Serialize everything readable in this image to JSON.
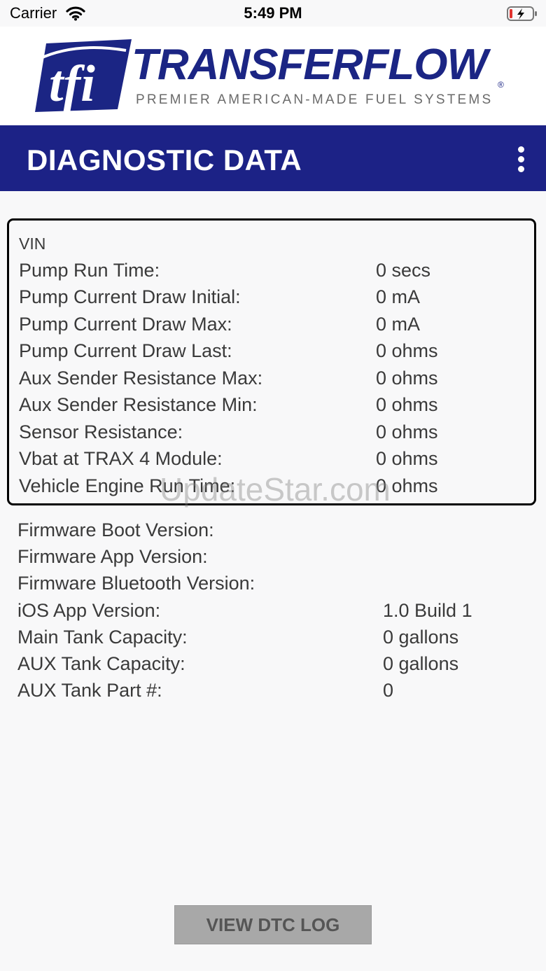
{
  "status_bar": {
    "carrier": "Carrier",
    "time": "5:49 PM",
    "wifi_icon": "wifi-icon",
    "battery_icon": "battery-charging-icon"
  },
  "brand": {
    "logo_mark": "tfi",
    "name": "TRANSFERFLOW",
    "registered": "®",
    "tagline": "PREMIER AMERICAN-MADE FUEL SYSTEMS",
    "color": "#1b2584"
  },
  "header": {
    "title": "DIAGNOSTIC DATA",
    "menu_icon": "more-vertical-icon",
    "color": "#1c2286"
  },
  "diagnostics": {
    "vin_label": "VIN",
    "rows": [
      {
        "label": "Pump Run Time:",
        "value": "0 secs"
      },
      {
        "label": "Pump Current Draw Initial:",
        "value": "0 mA"
      },
      {
        "label": "Pump Current Draw Max:",
        "value": "0 mA"
      },
      {
        "label": "Pump Current Draw Last:",
        "value": "0 ohms"
      },
      {
        "label": "Aux Sender Resistance Max:",
        "value": "0 ohms"
      },
      {
        "label": "Aux Sender Resistance Min:",
        "value": "0 ohms"
      },
      {
        "label": "Sensor Resistance:",
        "value": "0 ohms"
      },
      {
        "label": "Vbat at TRAX 4 Module:",
        "value": "0 ohms"
      },
      {
        "label": "Vehicle Engine Run Time:",
        "value": "0 ohms"
      }
    ]
  },
  "info": {
    "rows": [
      {
        "label": "Firmware Boot Version:",
        "value": ""
      },
      {
        "label": "Firmware App Version:",
        "value": ""
      },
      {
        "label": "Firmware Bluetooth Version:",
        "value": ""
      },
      {
        "label": "iOS App Version:",
        "value": "1.0 Build 1"
      },
      {
        "label": "Main Tank Capacity:",
        "value": "0 gallons"
      },
      {
        "label": "AUX Tank Capacity:",
        "value": "0 gallons"
      },
      {
        "label": "AUX Tank Part #:",
        "value": "0"
      }
    ]
  },
  "watermark": "UpdateStar.com",
  "actions": {
    "view_dtc_log": "VIEW DTC LOG"
  }
}
